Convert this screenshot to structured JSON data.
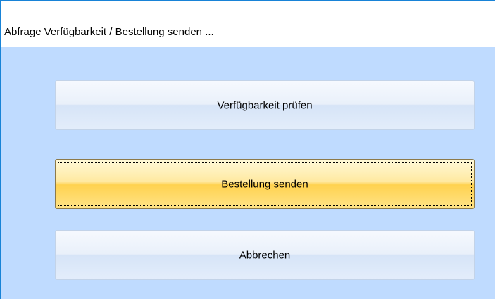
{
  "window": {
    "title": "Abfrage Verfügbarkeit / Bestellung senden ..."
  },
  "buttons": {
    "check_availability": "Verfügbarkeit prüfen",
    "send_order": "Bestellung senden",
    "cancel": "Abbrechen"
  },
  "colors": {
    "window_border": "#1883d7",
    "client_background": "#bfdbff",
    "default_button": "#ffd24f"
  }
}
